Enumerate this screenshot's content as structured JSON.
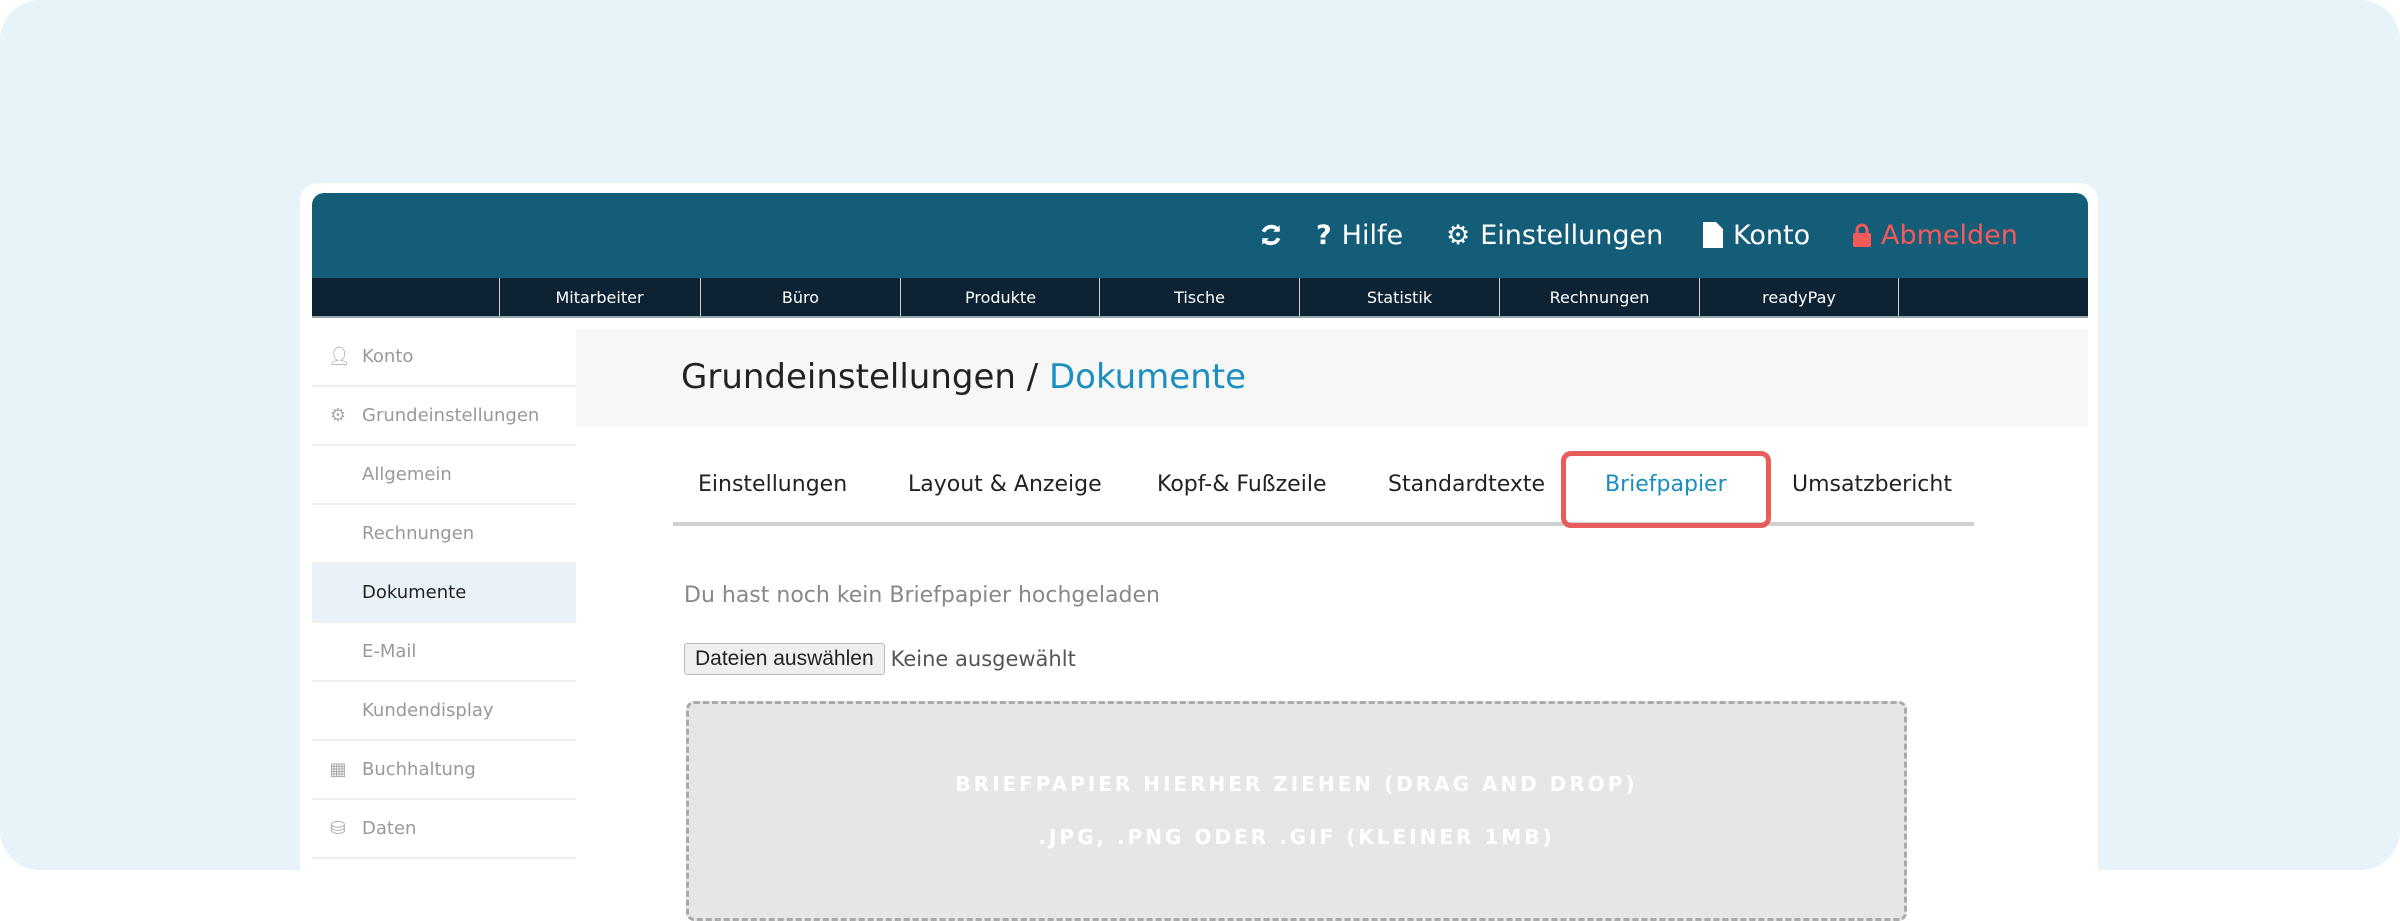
{
  "header": {
    "refresh_icon": "refresh-icon",
    "help": "Hilfe",
    "settings": "Einstellungen",
    "account": "Konto",
    "logout": "Abmelden",
    "logout_color": "#f25a5a"
  },
  "nav": [
    "Mitarbeiter",
    "Büro",
    "Produkte",
    "Tische",
    "Statistik",
    "Rechnungen",
    "readyPay"
  ],
  "sidebar": [
    {
      "label": "Konto",
      "icon": "user-icon"
    },
    {
      "label": "Grundeinstellungen",
      "icon": "gear-icon"
    },
    {
      "label": "Allgemein"
    },
    {
      "label": "Rechnungen"
    },
    {
      "label": "Dokumente",
      "active": true
    },
    {
      "label": "E-Mail"
    },
    {
      "label": "Kundendisplay"
    },
    {
      "label": "Buchhaltung",
      "icon": "calculator-icon"
    },
    {
      "label": "Daten",
      "icon": "database-icon"
    }
  ],
  "page": {
    "title_main": "Grundeinstellungen /",
    "title_highlight": "Dokumente"
  },
  "tabs": [
    "Einstellungen",
    "Layout & Anzeige",
    "Kopf-& Fußzeile",
    "Standardtexte",
    "Briefpapier",
    "Umsatzbericht"
  ],
  "active_tab": "Briefpapier",
  "content": {
    "info": "Du hast noch kein Briefpapier hochgeladen",
    "file_button": "Dateien auswählen",
    "file_status": "Keine ausgewählt",
    "drop_line1": "Briefpapier hierher ziehen (Drag and Drop)",
    "drop_line2": ".jpg, .png oder .gif (kleiner 1MB)"
  }
}
